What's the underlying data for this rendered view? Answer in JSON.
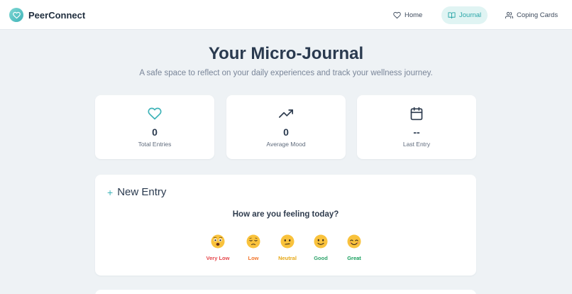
{
  "app": {
    "name": "PeerConnect"
  },
  "nav": {
    "home": "Home",
    "journal": "Journal",
    "coping": "Coping Cards"
  },
  "header": {
    "title": "Your Micro-Journal",
    "subtitle": "A safe space to reflect on your daily experiences and track your wellness journey."
  },
  "stats": [
    {
      "icon": "heart-icon",
      "value": "0",
      "label": "Total Entries"
    },
    {
      "icon": "trending-up-icon",
      "value": "0",
      "label": "Average Mood"
    },
    {
      "icon": "calendar-icon",
      "value": "--",
      "label": "Last Entry"
    }
  ],
  "entry": {
    "title": "New Entry",
    "question": "How are you feeling today?",
    "moods": [
      {
        "label": "Very Low",
        "color": "#e5484d"
      },
      {
        "label": "Low",
        "color": "#f2762e"
      },
      {
        "label": "Neutral",
        "color": "#e6a817"
      },
      {
        "label": "Good",
        "color": "#30a46c"
      },
      {
        "label": "Great",
        "color": "#18a05e"
      }
    ]
  },
  "colors": {
    "accent": "#3fb3b8",
    "accent_bg": "#e0f4f3",
    "background": "#eef2f5"
  }
}
